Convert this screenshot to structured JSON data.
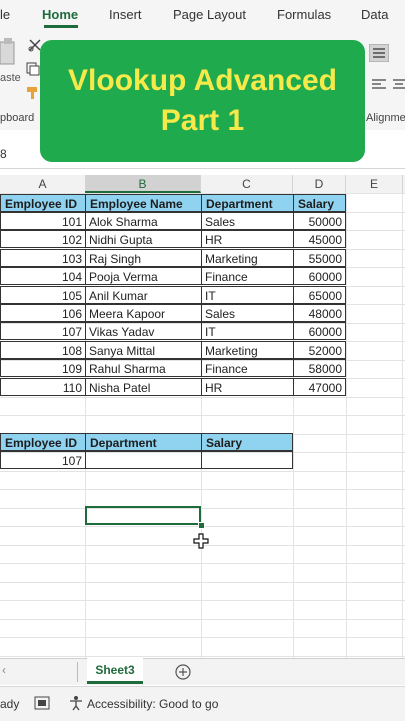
{
  "ribbon": {
    "tabs": [
      {
        "label": "le"
      },
      {
        "label": "Home"
      },
      {
        "label": "Insert"
      },
      {
        "label": "Page Layout"
      },
      {
        "label": "Formulas"
      },
      {
        "label": "Data"
      }
    ],
    "group_labels": [
      "pboard",
      "Alignme"
    ],
    "paste_label": "aste"
  },
  "banner": {
    "line1": "Vlookup Advanced",
    "line2": "Part 1",
    "background": "#1faa4e",
    "text_color": "#f6e94a"
  },
  "formula_bar": {
    "name_box": "8"
  },
  "columns": [
    "A",
    "B",
    "C",
    "D",
    "E"
  ],
  "table": {
    "headers": [
      "Employee ID",
      "Employee Name",
      "Department",
      "Salary"
    ],
    "rows": [
      [
        "101",
        "Alok Sharma",
        "Sales",
        "50000"
      ],
      [
        "102",
        "Nidhi Gupta",
        "HR",
        "45000"
      ],
      [
        "103",
        "Raj Singh",
        "Marketing",
        "55000"
      ],
      [
        "104",
        "Pooja Verma",
        "Finance",
        "60000"
      ],
      [
        "105",
        "Anil Kumar",
        "IT",
        "65000"
      ],
      [
        "106",
        "Meera Kapoor",
        "Sales",
        "48000"
      ],
      [
        "107",
        "Vikas Yadav",
        "IT",
        "60000"
      ],
      [
        "108",
        "Sanya Mittal",
        "Marketing",
        "52000"
      ],
      [
        "109",
        "Rahul Sharma",
        "Finance",
        "58000"
      ],
      [
        "110",
        "Nisha Patel",
        "HR",
        "47000"
      ]
    ],
    "header_color": "#8fd3f0"
  },
  "lookup": {
    "headers": [
      "Employee ID",
      "Department",
      "Salary"
    ],
    "employee_id": "107",
    "department": "",
    "salary": ""
  },
  "sheet": {
    "name": "Sheet3"
  },
  "status": {
    "ready": "ady",
    "accessibility": "Accessibility: Good to go"
  },
  "accent": "#1e6b3c"
}
